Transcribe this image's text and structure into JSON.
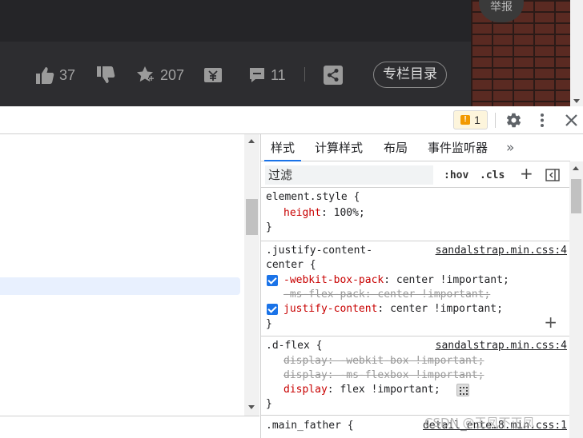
{
  "page": {
    "report_label": "举报",
    "actions": [
      {
        "name": "like",
        "count": "37"
      },
      {
        "name": "dislike",
        "count": ""
      },
      {
        "name": "favorite",
        "count": "207"
      },
      {
        "name": "reward",
        "count": ""
      },
      {
        "name": "comment",
        "count": "11"
      }
    ],
    "toc_label": "专栏目录"
  },
  "devtools": {
    "issues_count": "1",
    "tabs": [
      "样式",
      "计算样式",
      "布局",
      "事件监听器",
      "»"
    ],
    "active_tab": "样式",
    "filter": {
      "placeholder": "过滤",
      "hov": ":hov",
      "cls": ".cls"
    },
    "rules": [
      {
        "selector": "element.style {",
        "declarations": [
          {
            "property": "height",
            "value": "100%;"
          }
        ],
        "close": "}"
      },
      {
        "selector_line1": ".justify-content-",
        "selector_line2": "center {",
        "source": "sandalstrap.min.css:4",
        "declarations": [
          {
            "property": "-webkit-box-pack",
            "value": "center !important;",
            "checked": true
          },
          {
            "text": "-ms-flex-pack: center !important;",
            "struck": true
          },
          {
            "property": "justify-content",
            "value": "center !important;",
            "checked": true
          }
        ],
        "close": "}"
      },
      {
        "selector": ".d-flex {",
        "source": "sandalstrap.min.css:4",
        "declarations": [
          {
            "text": "display: -webkit-box !important;",
            "struck": true
          },
          {
            "text": "display: -ms-flexbox !important;",
            "struck": true
          },
          {
            "property": "display",
            "value": "flex !important;"
          }
        ],
        "close": "}"
      },
      {
        "selector": ".main_father {",
        "source": "detail_ente…8.min.css:1"
      }
    ]
  },
  "watermark": "CSDN @王凤不正凤"
}
